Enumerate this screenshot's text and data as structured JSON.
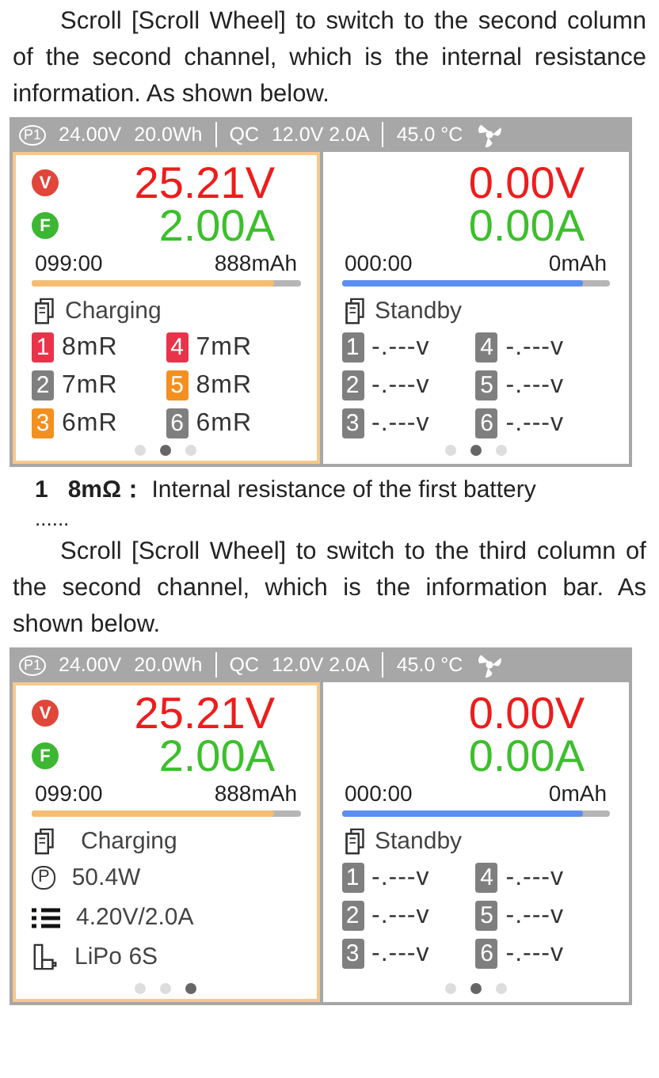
{
  "intro_1": "Scroll [Scroll Wheel] to switch to the second column of the second channel, which is the internal resistance information. As shown below.",
  "screen_1": {
    "status_bar": {
      "port": "P1",
      "input_voltage": "24.00V",
      "energy": "20.0Wh",
      "mode": "QC",
      "output": "12.0V 2.0A",
      "temperature": "45.0 °C"
    },
    "channels": [
      {
        "selected": true,
        "voltage_badge": "V",
        "current_badge": "F",
        "voltage": "25.21V",
        "current": "2.00A",
        "time": "099:00",
        "capacity": "888mAh",
        "level": 0.9,
        "color": "#f5bd72",
        "status": "Charging",
        "cells": [
          {
            "index": "1",
            "value": "8mR",
            "color": "#e8334a"
          },
          {
            "index": "4",
            "value": "7mR",
            "color": "#e8334a"
          },
          {
            "index": "2",
            "value": "7mR",
            "color": "#7f7f7f"
          },
          {
            "index": "5",
            "value": "8mR",
            "color": "#f39020"
          },
          {
            "index": "3",
            "value": "6mR",
            "color": "#f39020"
          },
          {
            "index": "6",
            "value": "6mR",
            "color": "#7f7f7f"
          }
        ],
        "pages": [
          {
            "selected": false
          },
          {
            "selected": true
          },
          {
            "selected": false
          }
        ]
      },
      {
        "selected": false,
        "voltage": "0.00V",
        "current": "0.00A",
        "time": "000:00",
        "capacity": "0mAh",
        "level": 0.9,
        "color": "#5b8ef0",
        "status": "Standby",
        "cells": [
          {
            "index": "1",
            "value": "-.---v",
            "color": "#7f7f7f"
          },
          {
            "index": "4",
            "value": "-.---v",
            "color": "#7f7f7f"
          },
          {
            "index": "2",
            "value": "-.---v",
            "color": "#7f7f7f"
          },
          {
            "index": "5",
            "value": "-.---v",
            "color": "#7f7f7f"
          },
          {
            "index": "3",
            "value": "-.---v",
            "color": "#7f7f7f"
          },
          {
            "index": "6",
            "value": "-.---v",
            "color": "#7f7f7f"
          }
        ],
        "pages": [
          {
            "selected": false
          },
          {
            "selected": true
          },
          {
            "selected": false
          }
        ]
      }
    ]
  },
  "note": "**1   8mΩ：** Internal resistance of the first battery",
  "ellipsis": "......",
  "intro_2": "Scroll [Scroll Wheel] to switch to the third column of the second channel, which is the information bar. As shown below.",
  "screen_2": {
    "status_bar": {
      "port": "P1",
      "input_voltage": "24.00V",
      "energy": "20.0Wh",
      "mode": "QC",
      "output": "12.0V 2.0A",
      "temperature": "45.0 °C"
    },
    "channels": [
      {
        "selected": true,
        "voltage_badge": "V",
        "current_badge": "F",
        "voltage": "25.21V",
        "current": "2.00A",
        "time": "099:00",
        "capacity": "888mAh",
        "level": 0.9,
        "color": "#f5bd72",
        "status": "Charging",
        "info": [
          {
            "kind": "power",
            "badge": "P",
            "text": "50.4W"
          },
          {
            "kind": "settings",
            "text": "4.20V/2.0A"
          },
          {
            "kind": "battery",
            "text": "LiPo 6S"
          }
        ],
        "pages": [
          {
            "selected": false
          },
          {
            "selected": false
          },
          {
            "selected": true
          }
        ]
      },
      {
        "selected": false,
        "voltage": "0.00V",
        "current": "0.00A",
        "time": "000:00",
        "capacity": "0mAh",
        "level": 0.9,
        "color": "#5b8ef0",
        "status": "Standby",
        "cells": [
          {
            "index": "1",
            "value": "-.---v",
            "color": "#7f7f7f"
          },
          {
            "index": "4",
            "value": "-.---v",
            "color": "#7f7f7f"
          },
          {
            "index": "2",
            "value": "-.---v",
            "color": "#7f7f7f"
          },
          {
            "index": "5",
            "value": "-.---v",
            "color": "#7f7f7f"
          },
          {
            "index": "3",
            "value": "-.---v",
            "color": "#7f7f7f"
          },
          {
            "index": "6",
            "value": "-.---v",
            "color": "#7f7f7f"
          }
        ],
        "pages": [
          {
            "selected": false
          },
          {
            "selected": true
          },
          {
            "selected": false
          }
        ]
      }
    ]
  }
}
